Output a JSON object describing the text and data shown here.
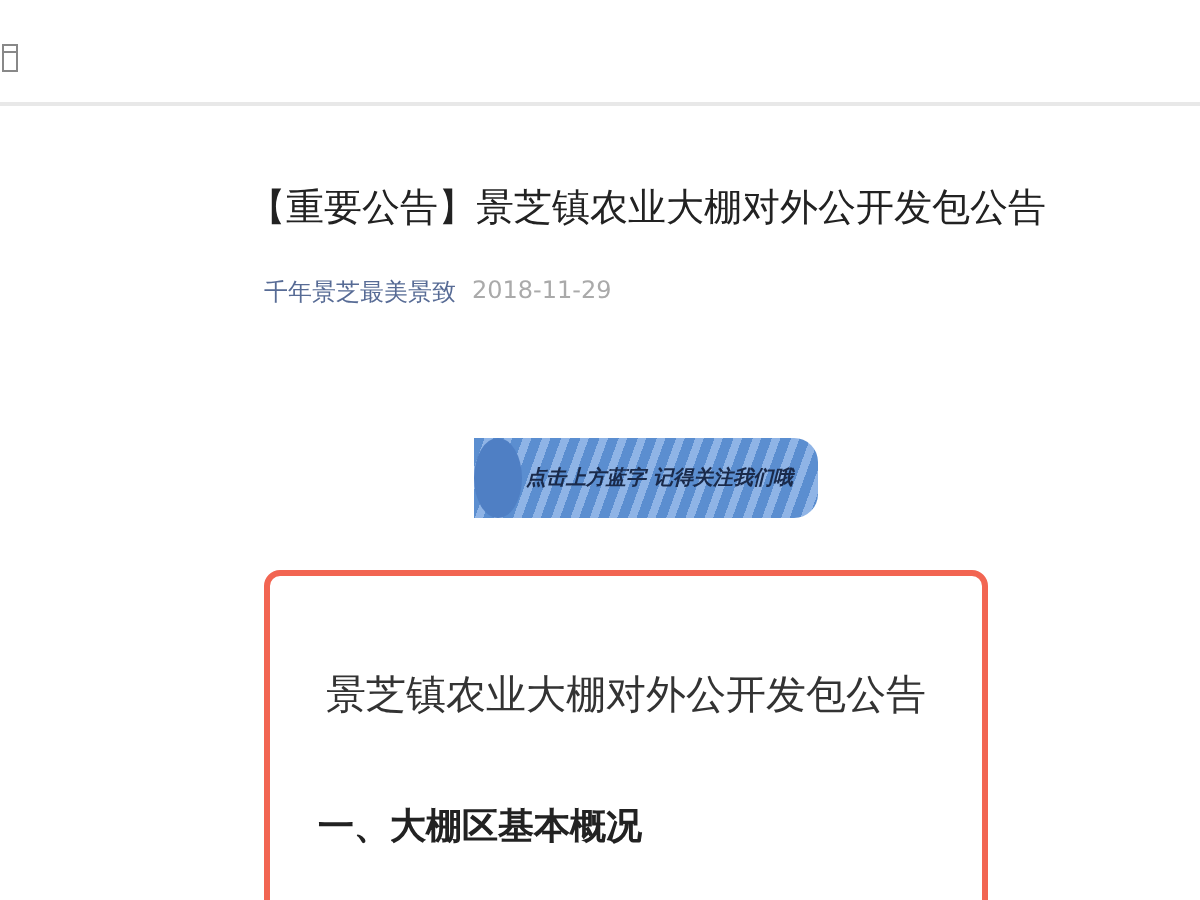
{
  "article": {
    "title": "【重要公告】景芝镇农业大棚对外公开发包公告",
    "author": "千年景芝最美景致",
    "date": "2018-11-29"
  },
  "banner": {
    "text": "点击上方蓝字 记得关注我们哦"
  },
  "card": {
    "title": "景芝镇农业大棚对外公开发包公告",
    "heading": "一、大棚区基本概况"
  }
}
